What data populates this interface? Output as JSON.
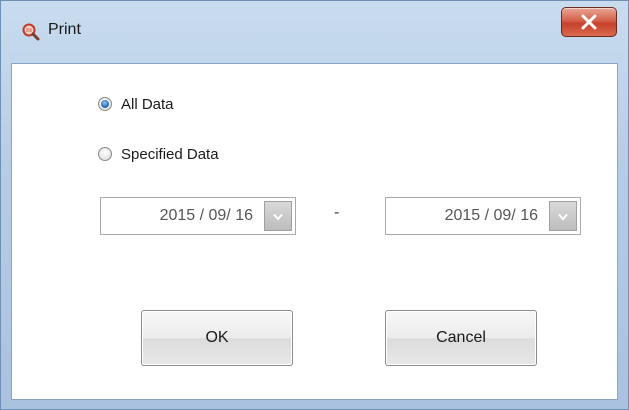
{
  "window": {
    "title": "Print",
    "title_icon": "print-preview-icon",
    "close_icon": "close-icon",
    "close_label": "X"
  },
  "options": {
    "all_data_label": "All Data",
    "specified_data_label": "Specified Data",
    "selected": "All Data"
  },
  "date_range": {
    "start": "2015 / 09/ 16",
    "separator": "-",
    "end": "2015 / 09/ 16",
    "dropdown_icon": "chevron-down-icon"
  },
  "buttons": {
    "ok_label": "OK",
    "cancel_label": "Cancel"
  },
  "colors": {
    "title_bar": "#b6cde6",
    "close_button": "#c7412b",
    "radio_selected": "#2f6fb3"
  }
}
